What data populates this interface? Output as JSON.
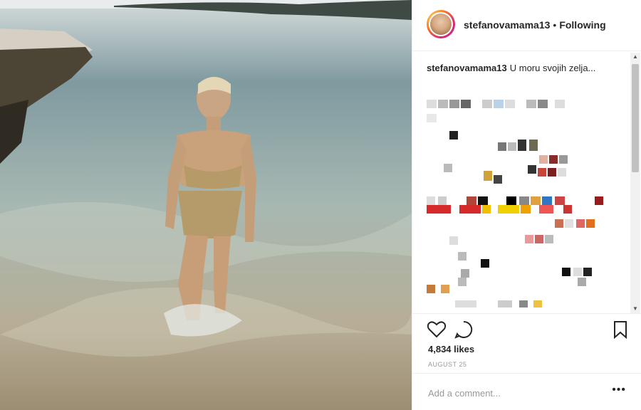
{
  "post": {
    "username": "stefanovamama13",
    "separator": "•",
    "follow_status": "Following",
    "caption_text": "U moru svojih zelja...",
    "likes": "4,834 likes",
    "date": "AUGUST 25",
    "comment_placeholder": "Add a comment...",
    "more_label": "•••"
  },
  "icons": {
    "like": "heart-icon",
    "comment": "comment-icon",
    "save": "bookmark-icon",
    "avatar": "profile-avatar"
  },
  "colors": {
    "text": "#262626",
    "muted": "#999999",
    "border": "#efefef"
  }
}
